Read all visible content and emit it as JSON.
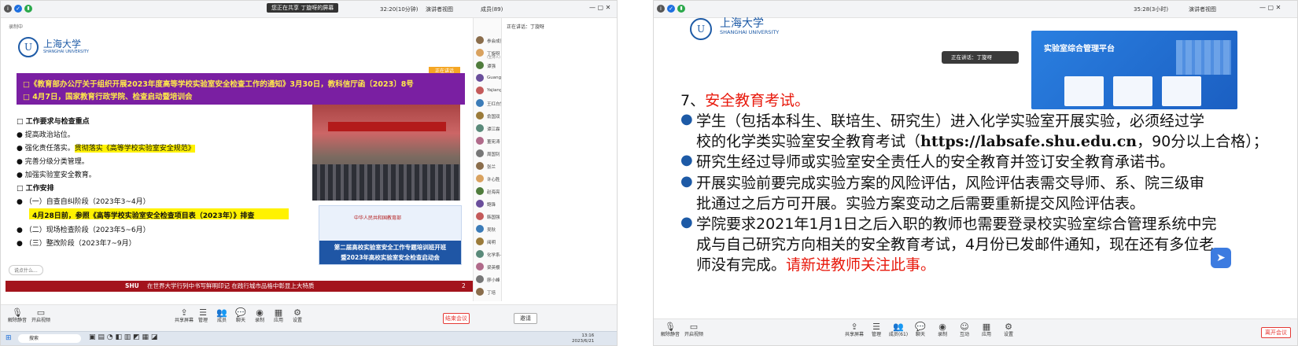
{
  "left": {
    "topbar": {
      "share_label": "您正在共享 丁旋呀的屏幕",
      "time_label": "32:20(10分钟)",
      "view_label": "演讲者视图",
      "members_label": "成员(89)"
    },
    "slide": {
      "recording_label": "录制中",
      "logo_cn": "上海大学",
      "logo_en": "SHANGHAI UNIVERSITY",
      "speaker_tag": "正在讲话",
      "notice_lines": [
        "□《教育部办公厅关于组织开展2023年度高等学校实验室安全检查工作的通知》3月30日，教科信厅函〔2023〕8号",
        "□ 4月7日，国家教育行政学院、检查启动暨培训会"
      ],
      "section1_title": "□  工作要求与检查重点",
      "bullets1": [
        "提高政治站位。",
        "强化责任落实。",
        "完善分级分类管理。",
        "加强实验室安全教育。"
      ],
      "bullet1_highlight": "贯彻落实《高等学校实验室安全规范》",
      "section2_title": "□  工作安排",
      "stage1": "（一）自查自纠阶段（2023年3~4月）",
      "stage1_highlight": "4月28日前，参照《高等学校实验室安全检查项目表（2023年）》排查",
      "stage2": "（二）现场检查阶段（2023年5~6月）",
      "stage3": "（三）整改阶段（2023年7~9月）",
      "poster_org": "中华人民共和国教育部",
      "poster_title_1": "第二届高校实验室安全工作专题培训班开班",
      "poster_title_2": "暨2023年高校实验室安全检查启动会",
      "footer_brand": "SHU",
      "footer_slogan": "在世界大学行列中书写鲜明印记  在践行城市品格中彰显上大特质",
      "page_number": "2",
      "chat_input": "说点什么..."
    },
    "participants": [
      {
        "name": "参会成员",
        "status": ""
      },
      {
        "name": "丁旋呀",
        "status": "(主持人)"
      },
      {
        "name": "谭强",
        "status": ""
      },
      {
        "name": "Guangjun",
        "status": ""
      },
      {
        "name": "Yajiang",
        "status": ""
      },
      {
        "name": "王红白雪风",
        "status": ""
      },
      {
        "name": "俞国双",
        "status": ""
      },
      {
        "name": "谭江霖",
        "status": ""
      },
      {
        "name": "董宪涛",
        "status": ""
      },
      {
        "name": "周国钊",
        "status": ""
      },
      {
        "name": "张兰",
        "status": ""
      },
      {
        "name": "许心胜",
        "status": ""
      },
      {
        "name": "赵海亮",
        "status": ""
      },
      {
        "name": "鲍锋",
        "status": ""
      },
      {
        "name": "韩国强",
        "status": ""
      },
      {
        "name": "吴秋",
        "status": ""
      },
      {
        "name": "阅明",
        "status": ""
      },
      {
        "name": "化学系-任海波",
        "status": ""
      },
      {
        "name": "梁英樱",
        "status": ""
      },
      {
        "name": "廖小峰",
        "status": ""
      },
      {
        "name": "丁培",
        "status": ""
      }
    ],
    "participant_status_word": "相机",
    "chat_panel_title": "正在讲话：丁旋呀",
    "toolbar": {
      "mute": "解除静音",
      "camera": "开启视频",
      "share": "共享屏幕",
      "manage": "管理",
      "members": "成员",
      "chat": "聊天",
      "record": "录制",
      "apps": "应用",
      "settings": "设置",
      "end": "结束会议",
      "invite": "邀请"
    },
    "taskbar": {
      "search": "搜索",
      "time": "13:16",
      "date": "2023/6/21"
    }
  },
  "right": {
    "topbar": {
      "time_label": "35:28(3小时)",
      "view_label": "演讲者视图"
    },
    "logo_cn": "上海大学",
    "logo_en": "SHANGHAI UNIVERSITY",
    "speaker_label": "正在讲话：丁旋呀",
    "platform_title": "实验室综合管理平台",
    "heading_num": "7、",
    "heading_text": "安全教育考试。",
    "p1_line1": "学生（包括本科生、联培生、研究生）进入化学实验室开展实验，必须经过学",
    "p1_line2a": "校的化学类实验室安全教育考试（",
    "p1_url": "https://labsafe.shu.edu.cn",
    "p1_line2b": "，90分以上合格）；",
    "p2": "研究生经过导师或实验室安全责任人的安全教育并签订安全教育承诺书。",
    "p3_line1": "开展实验前要完成实验方案的风险评估，风险评估表需交导师、系、院三级审",
    "p3_line2": "批通过之后方可开展。实验方案变动之后需要重新提交风险评估表。",
    "p4_line1": "学院要求2021年1月1日之后入职的教师也需要登录校实验室综合管理系统中完",
    "p4_line2": "成与自己研究方向相关的安全教育考试，4月份已发邮件通知，现在还有多位老",
    "p4_line3a": "师没有完成。",
    "p4_line3b": "请新进教师关注此事。",
    "toolbar": {
      "mute": "解除静音",
      "camera": "开启视频",
      "share": "共享屏幕",
      "manage": "管理",
      "members": "成员(61)",
      "chat": "聊天",
      "record": "录制",
      "interact": "互动",
      "apps": "应用",
      "settings": "设置",
      "end": "离开会议"
    }
  },
  "colors": {
    "purple_banner": "#7a1fa2",
    "notice_text": "#ffe94a",
    "highlight": "#fff200",
    "shu_blue": "#1d5aa6",
    "footer_red": "#a3141c",
    "emphasis_red": "#e8190c"
  }
}
